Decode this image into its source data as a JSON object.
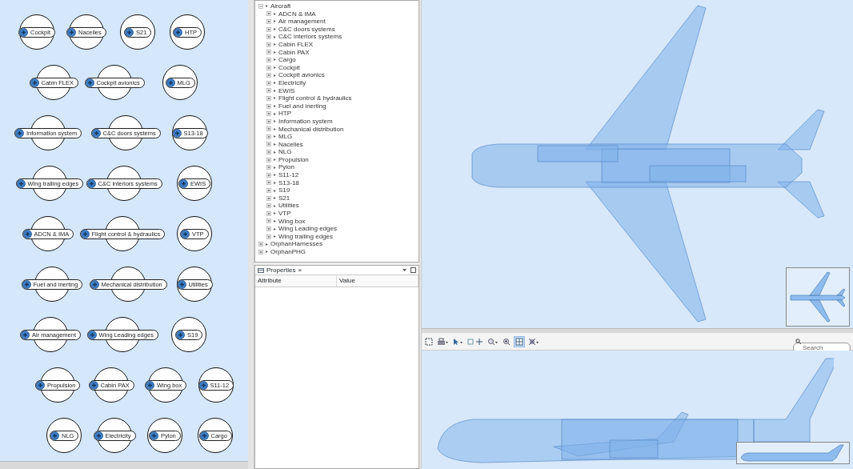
{
  "diagram": {
    "nodes": [
      {
        "label": "Cockpit"
      },
      {
        "label": "Nacelles"
      },
      {
        "label": "S21"
      },
      {
        "label": "HTP"
      },
      {
        "label": "Cabin FLEX"
      },
      {
        "label": "Cockpit avionics"
      },
      {
        "label": "MLG"
      },
      {
        "label": "Information system"
      },
      {
        "label": "C&C doors systems"
      },
      {
        "label": "S13-18"
      },
      {
        "label": "Wing trailing edges"
      },
      {
        "label": "C&C interiors systems"
      },
      {
        "label": "EWIS"
      },
      {
        "label": "ADCN & IMA"
      },
      {
        "label": "Flight control & hydraulics"
      },
      {
        "label": "VTP"
      },
      {
        "label": "Fuel and inerting"
      },
      {
        "label": "Mechanical distribution"
      },
      {
        "label": "Utilities"
      },
      {
        "label": "Air management"
      },
      {
        "label": "Wing Leading edges"
      },
      {
        "label": "S19"
      },
      {
        "label": "Propulsion"
      },
      {
        "label": "Cabin PAX"
      },
      {
        "label": "Wing box"
      },
      {
        "label": "S11-12"
      },
      {
        "label": "NLG"
      },
      {
        "label": "Electricity"
      },
      {
        "label": "Pylon"
      },
      {
        "label": "Cargo"
      }
    ]
  },
  "tree": {
    "items": [
      {
        "label": "Aircraft",
        "expanded": true,
        "children": [
          {
            "label": "ADCN & IMA",
            "expanded": false
          },
          {
            "label": "Air management",
            "expanded": false
          },
          {
            "label": "C&C doors systems",
            "expanded": false
          },
          {
            "label": "C&C interiors systems",
            "expanded": false
          },
          {
            "label": "Cabin FLEX",
            "expanded": false
          },
          {
            "label": "Cabin PAX",
            "expanded": false
          },
          {
            "label": "Cargo",
            "expanded": false
          },
          {
            "label": "Cockpit",
            "expanded": false
          },
          {
            "label": "Cockpit avionics",
            "expanded": false
          },
          {
            "label": "Electricity",
            "expanded": false
          },
          {
            "label": "EWIS",
            "expanded": false
          },
          {
            "label": "Flight control & hydraulics",
            "expanded": false
          },
          {
            "label": "Fuel and inerting",
            "expanded": false
          },
          {
            "label": "HTP",
            "expanded": false
          },
          {
            "label": "Information system",
            "expanded": false
          },
          {
            "label": "Mechanical distribution",
            "expanded": false
          },
          {
            "label": "MLG",
            "expanded": false
          },
          {
            "label": "Nacelles",
            "expanded": false
          },
          {
            "label": "NLG",
            "expanded": false
          },
          {
            "label": "Propulsion",
            "expanded": false
          },
          {
            "label": "Pylon",
            "expanded": false
          },
          {
            "label": "S11-12",
            "expanded": false
          },
          {
            "label": "S13-18",
            "expanded": false
          },
          {
            "label": "S19",
            "expanded": false
          },
          {
            "label": "S21",
            "expanded": false
          },
          {
            "label": "Utilities",
            "expanded": false
          },
          {
            "label": "VTP",
            "expanded": false
          },
          {
            "label": "Wing box",
            "expanded": false
          },
          {
            "label": "Wing Leading edges",
            "expanded": false
          },
          {
            "label": "Wing trailing edges",
            "expanded": false
          }
        ]
      },
      {
        "label": "OrphanHarnesses",
        "expanded": false
      },
      {
        "label": "OrphanPHG",
        "expanded": false
      }
    ]
  },
  "properties": {
    "tab": "Properties",
    "close": "×",
    "columns": [
      "Attribute",
      "Value"
    ]
  },
  "toolbar": {
    "search": {
      "placeholder": "Search"
    }
  }
}
